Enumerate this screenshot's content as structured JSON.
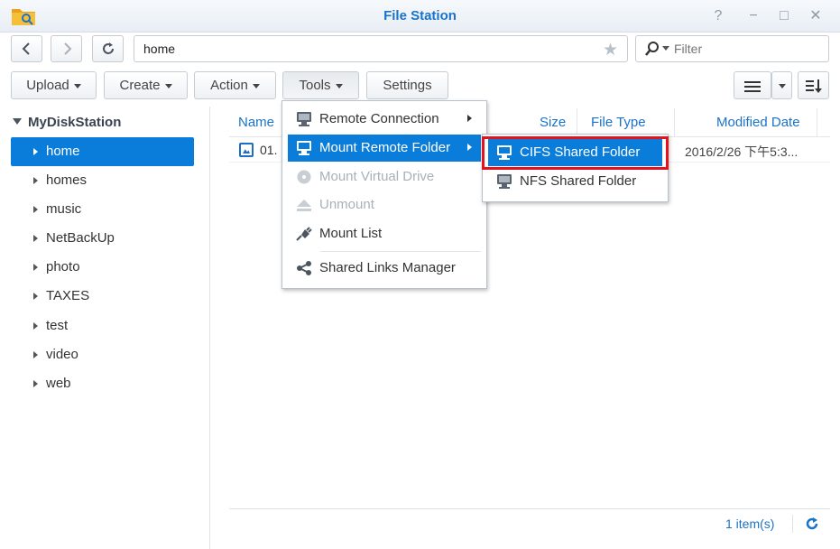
{
  "window": {
    "title": "File Station",
    "colors": {
      "accent": "#0a7ddb",
      "title": "#1a73c8",
      "highlight_box": "#e3121e"
    }
  },
  "window_controls": {
    "help": "?",
    "minimize": "−",
    "maximize": "□",
    "close": "✕"
  },
  "nav": {
    "path": "home",
    "filter_placeholder": "Filter"
  },
  "toolbar": {
    "upload": "Upload",
    "create": "Create",
    "action": "Action",
    "tools": "Tools",
    "settings": "Settings"
  },
  "sidebar": {
    "root": "MyDiskStation",
    "items": [
      {
        "label": "home",
        "selected": true
      },
      {
        "label": "homes"
      },
      {
        "label": "music"
      },
      {
        "label": "NetBackUp"
      },
      {
        "label": "photo"
      },
      {
        "label": "TAXES"
      },
      {
        "label": "test"
      },
      {
        "label": "video"
      },
      {
        "label": "web"
      }
    ]
  },
  "filelist": {
    "columns": {
      "name": "Name",
      "size": "Size",
      "type": "File Type",
      "modified": "Modified Date"
    },
    "rows": [
      {
        "name": "01.",
        "modified": "2016/2/26 下午5:3..."
      }
    ]
  },
  "status": {
    "count": "1 item(s)"
  },
  "tools_menu": {
    "items": [
      {
        "label": "Remote Connection",
        "icon": "monitor-icon",
        "submenu": true
      },
      {
        "label": "Mount Remote Folder",
        "icon": "monitor-icon",
        "submenu": true,
        "highlighted": true
      },
      {
        "label": "Mount Virtual Drive",
        "icon": "disc-icon",
        "disabled": true
      },
      {
        "label": "Unmount",
        "icon": "eject-icon",
        "disabled": true
      },
      {
        "label": "Mount List",
        "icon": "plug-icon"
      },
      {
        "label": "Shared Links Manager",
        "icon": "share-icon"
      }
    ]
  },
  "mount_submenu": {
    "items": [
      {
        "label": "CIFS Shared Folder",
        "icon": "monitor-icon",
        "highlighted": true
      },
      {
        "label": "NFS Shared Folder",
        "icon": "monitor-icon"
      }
    ]
  }
}
